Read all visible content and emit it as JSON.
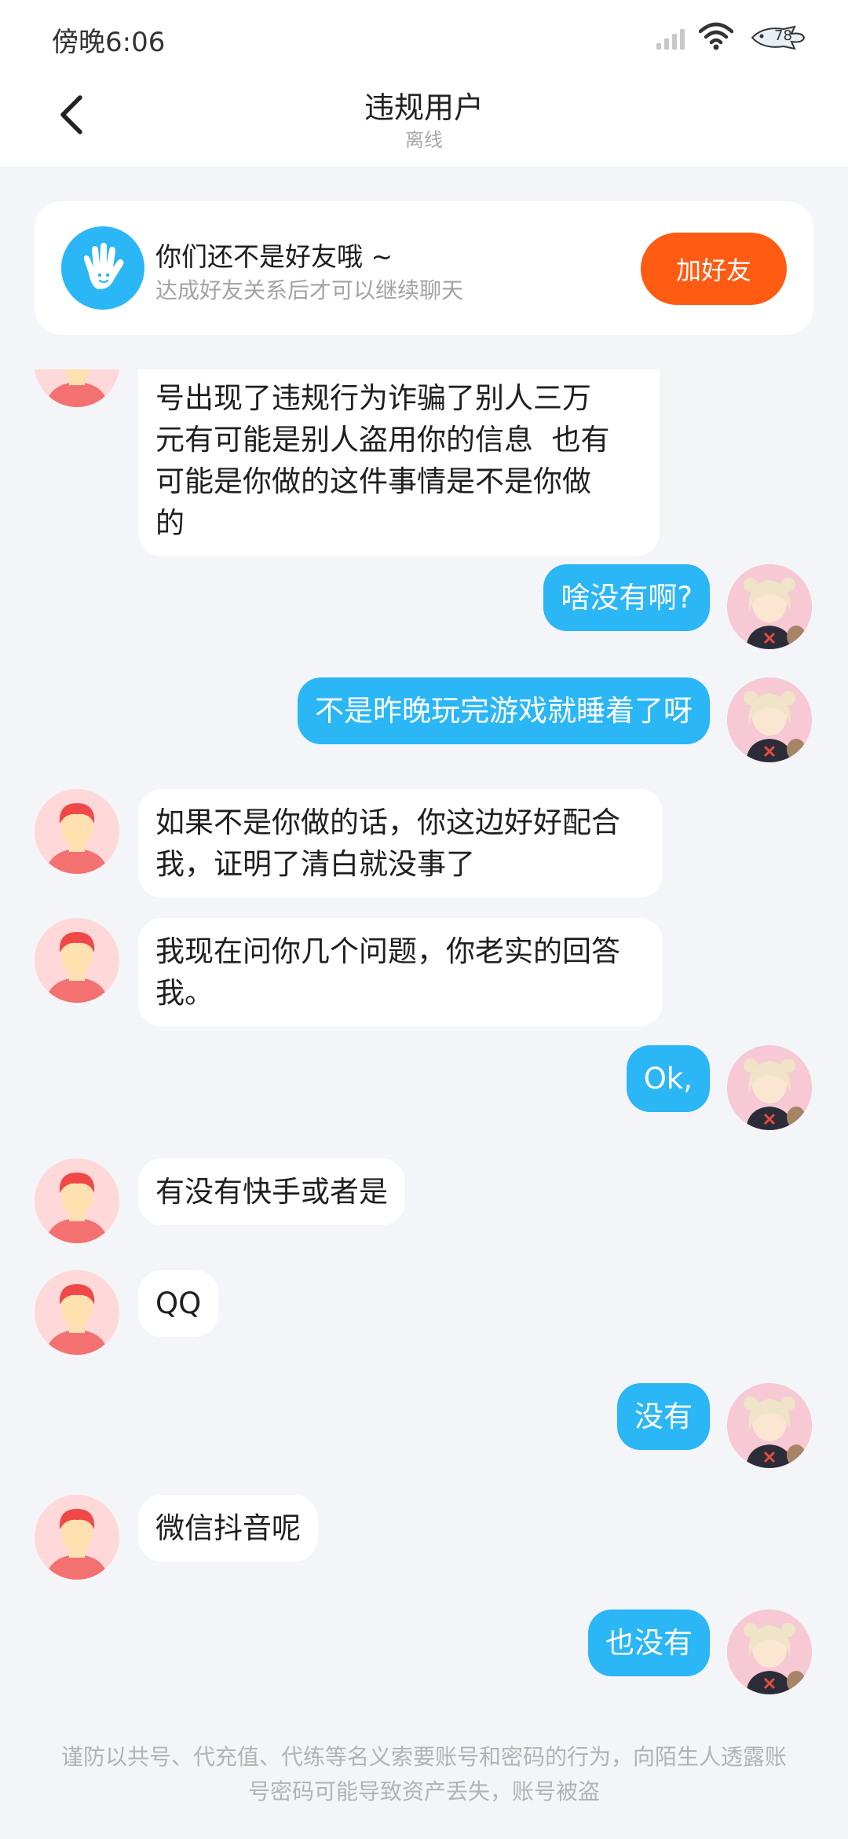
{
  "status_bar": {
    "time": "傍晚6:06",
    "battery_level": "78",
    "icons": [
      "signal-icon",
      "wifi-icon",
      "battery-icon"
    ]
  },
  "header": {
    "title": "违规用户",
    "subtitle": "离线",
    "back_icon": "chevron-left-icon"
  },
  "friend_banner": {
    "title": "你们还不是好友哦 ~",
    "subtitle": "达成好友关系后才可以继续聊天",
    "button_label": "加好友",
    "icon": "waving-hand-icon",
    "button_color": "#ff5b12"
  },
  "messages": [
    {
      "side": "in",
      "text": "号出现了违规行为诈骗了别人三万\n元有可能是别人盗用你的信息  也有\n可能是你做的这件事情是不是你做\n的"
    },
    {
      "side": "out",
      "text": "啥没有啊?"
    },
    {
      "side": "out",
      "text": "不是昨晚玩完游戏就睡着了呀"
    },
    {
      "side": "in",
      "text": "如果不是你做的话，你这边好好配合\n我，证明了清白就没事了"
    },
    {
      "side": "in",
      "text": "我现在问你几个问题，你老实的回答\n我。"
    },
    {
      "side": "out",
      "text": "Ok,"
    },
    {
      "side": "in",
      "text": "有没有快手或者是"
    },
    {
      "side": "in",
      "text": "QQ"
    },
    {
      "side": "out",
      "text": "没有"
    },
    {
      "side": "in",
      "text": "微信抖音呢"
    },
    {
      "side": "out",
      "text": "也没有"
    }
  ],
  "footer": {
    "disclaimer": "谨防以共号、代充值、代练等名义索要账号和密码的行为，向陌生人透露账号密码可能导致资产丢失，账号被盗"
  },
  "colors": {
    "outgoing_bubble": "#2bb6f6",
    "incoming_bubble": "#ffffff",
    "background": "#f3f5f8"
  }
}
